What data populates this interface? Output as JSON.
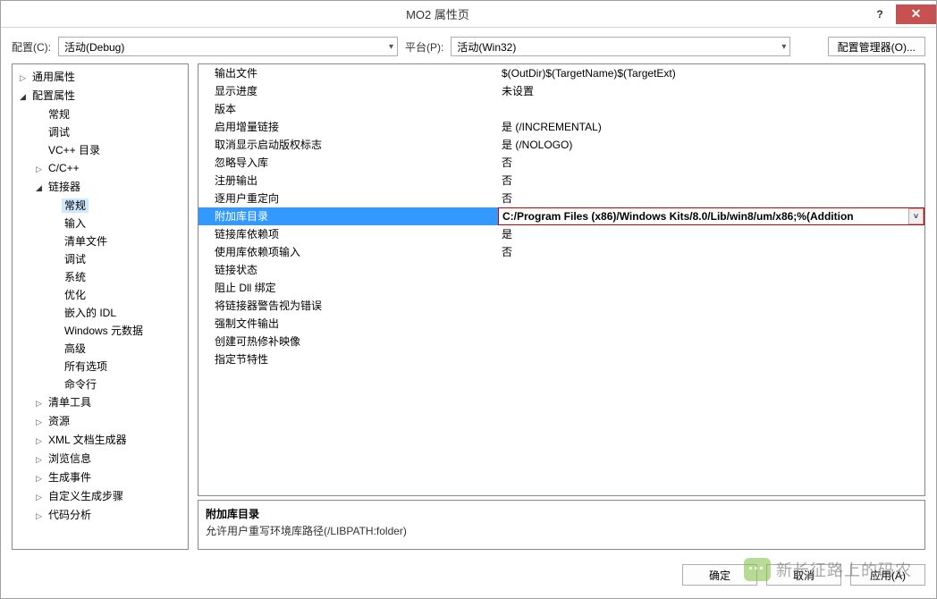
{
  "window": {
    "title": "MO2 属性页",
    "help_glyph": "?",
    "close_glyph": "✕"
  },
  "toolbar": {
    "config_label": "配置(C):",
    "config_value": "活动(Debug)",
    "platform_label": "平台(P):",
    "platform_value": "活动(Win32)",
    "manager_label": "配置管理器(O)..."
  },
  "tree": [
    {
      "label": "通用属性",
      "depth": 0,
      "expander": "▷"
    },
    {
      "label": "配置属性",
      "depth": 0,
      "expander": "◢"
    },
    {
      "label": "常规",
      "depth": 1,
      "expander": ""
    },
    {
      "label": "调试",
      "depth": 1,
      "expander": ""
    },
    {
      "label": "VC++ 目录",
      "depth": 1,
      "expander": ""
    },
    {
      "label": "C/C++",
      "depth": 1,
      "expander": "▷"
    },
    {
      "label": "链接器",
      "depth": 1,
      "expander": "◢"
    },
    {
      "label": "常规",
      "depth": 2,
      "expander": "",
      "selected": true
    },
    {
      "label": "输入",
      "depth": 2,
      "expander": ""
    },
    {
      "label": "清单文件",
      "depth": 2,
      "expander": ""
    },
    {
      "label": "调试",
      "depth": 2,
      "expander": ""
    },
    {
      "label": "系统",
      "depth": 2,
      "expander": ""
    },
    {
      "label": "优化",
      "depth": 2,
      "expander": ""
    },
    {
      "label": "嵌入的 IDL",
      "depth": 2,
      "expander": ""
    },
    {
      "label": "Windows 元数据",
      "depth": 2,
      "expander": ""
    },
    {
      "label": "高级",
      "depth": 2,
      "expander": ""
    },
    {
      "label": "所有选项",
      "depth": 2,
      "expander": ""
    },
    {
      "label": "命令行",
      "depth": 2,
      "expander": ""
    },
    {
      "label": "清单工具",
      "depth": 1,
      "expander": "▷"
    },
    {
      "label": "资源",
      "depth": 1,
      "expander": "▷"
    },
    {
      "label": "XML 文档生成器",
      "depth": 1,
      "expander": "▷"
    },
    {
      "label": "浏览信息",
      "depth": 1,
      "expander": "▷"
    },
    {
      "label": "生成事件",
      "depth": 1,
      "expander": "▷"
    },
    {
      "label": "自定义生成步骤",
      "depth": 1,
      "expander": "▷"
    },
    {
      "label": "代码分析",
      "depth": 1,
      "expander": "▷"
    }
  ],
  "grid": [
    {
      "name": "输出文件",
      "value": "$(OutDir)$(TargetName)$(TargetExt)"
    },
    {
      "name": "显示进度",
      "value": "未设置"
    },
    {
      "name": "版本",
      "value": ""
    },
    {
      "name": "启用增量链接",
      "value": "是 (/INCREMENTAL)"
    },
    {
      "name": "取消显示启动版权标志",
      "value": "是 (/NOLOGO)"
    },
    {
      "name": "忽略导入库",
      "value": "否"
    },
    {
      "name": "注册输出",
      "value": "否"
    },
    {
      "name": "逐用户重定向",
      "value": "否"
    },
    {
      "name": "附加库目录",
      "value": "C:/Program Files (x86)/Windows Kits/8.0/Lib/win8/um/x86;%(Addition",
      "selected": true
    },
    {
      "name": "链接库依赖项",
      "value": "是"
    },
    {
      "name": "使用库依赖项输入",
      "value": "否"
    },
    {
      "name": "链接状态",
      "value": ""
    },
    {
      "name": "阻止 Dll 绑定",
      "value": ""
    },
    {
      "name": "将链接器警告视为错误",
      "value": ""
    },
    {
      "name": "强制文件输出",
      "value": ""
    },
    {
      "name": "创建可热修补映像",
      "value": ""
    },
    {
      "name": "指定节特性",
      "value": ""
    }
  ],
  "description": {
    "title": "附加库目录",
    "text": "允许用户重写环境库路径(/LIBPATH:folder)"
  },
  "buttons": {
    "ok": "确定",
    "cancel": "取消",
    "apply": "应用(A)"
  },
  "watermark": "新长征路上的码农"
}
